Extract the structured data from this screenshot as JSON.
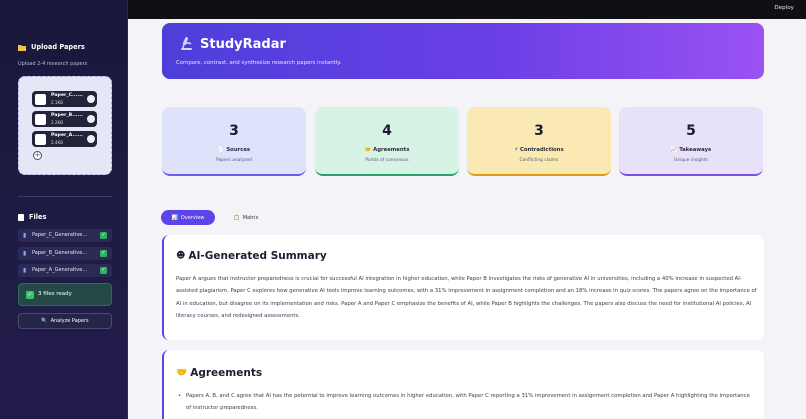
{
  "topbar": {
    "deploy_label": "Deploy"
  },
  "sidebar": {
    "upload_title": "Upload Papers",
    "upload_icon": "folder-icon",
    "upload_subtitle": "Upload 2-4 research papers",
    "uploaded": [
      {
        "name": "Paper_C......",
        "size": "2.1KB"
      },
      {
        "name": "Paper_B......",
        "size": "2.2KB"
      },
      {
        "name": "Paper_A......",
        "size": "2.4KB"
      }
    ],
    "files_title": "Files",
    "files": [
      {
        "name": "Paper_C_Generative..."
      },
      {
        "name": "Paper_B_Generative..."
      },
      {
        "name": "Paper_A_Generative..."
      }
    ],
    "ready_text": "3 files ready",
    "analyze_label": "Analyze Papers"
  },
  "hero": {
    "title": "StudyRadar",
    "subtitle": "Compare, contrast, and synthesize research papers instantly."
  },
  "stats": [
    {
      "value": "3",
      "label": "Sources",
      "sub": "Papers analyzed",
      "icon": "document-icon",
      "bg": "#dfe2fb",
      "border": "#6b5cf0"
    },
    {
      "value": "4",
      "label": "Agreements",
      "sub": "Points of consensus",
      "icon": "handshake-icon",
      "bg": "#d6f3e6",
      "border": "#24a46a"
    },
    {
      "value": "3",
      "label": "Contradictions",
      "sub": "Conflicting claims",
      "icon": "lightning-icon",
      "bg": "#fbe9b3",
      "border": "#e19a12"
    },
    {
      "value": "5",
      "label": "Takeaways",
      "sub": "Unique insights",
      "icon": "chart-icon",
      "bg": "#e8e1fa",
      "border": "#7b4fe0"
    }
  ],
  "tabs": {
    "overview": "Overview",
    "matrix": "Matrix"
  },
  "summary": {
    "title": "AI-Generated Summary",
    "body": "Paper A argues that instructor preparedness is crucial for successful AI integration in higher education, while Paper B investigates the risks of generative AI in universities, including a 40% increase in suspected AI-assisted plagiarism. Paper C explores how generative AI tools improve learning outcomes, with a 31% improvement in assignment completion and an 18% increase in quiz scores. The papers agree on the importance of AI in education, but disagree on its implementation and risks. Paper A and Paper C emphasize the benefits of AI, while Paper B highlights the challenges. The papers also discuss the need for institutional AI policies, AI literacy courses, and redesigned assessments."
  },
  "agreements": {
    "title": "Agreements",
    "bullet1": "Papers A, B, and C agree that AI has the potential to improve learning outcomes in higher education, with Paper C reporting a 31% improvement in assignment completion and Paper A highlighting the importance of instructor preparedness."
  }
}
